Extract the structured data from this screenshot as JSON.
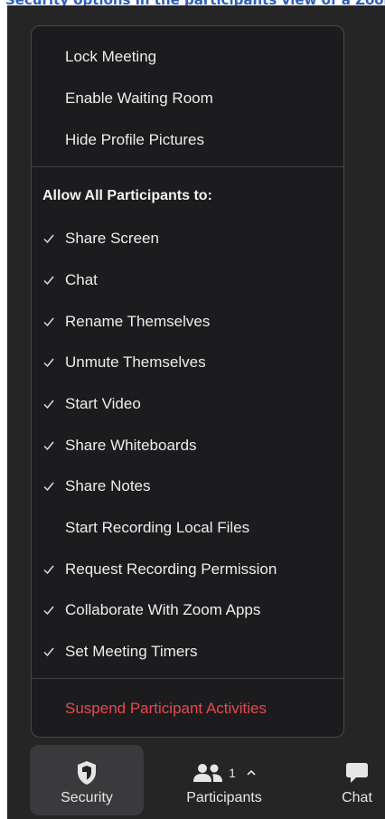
{
  "top_strip": {
    "text": "Security options in the participants view of a Zoom meeting"
  },
  "menu": {
    "top_items": [
      {
        "label": "Lock Meeting",
        "checked": false
      },
      {
        "label": "Enable Waiting Room",
        "checked": false
      },
      {
        "label": "Hide Profile Pictures",
        "checked": false
      }
    ],
    "section_heading": "Allow All Participants to:",
    "permissions": [
      {
        "label": "Share Screen",
        "checked": true
      },
      {
        "label": "Chat",
        "checked": true
      },
      {
        "label": "Rename Themselves",
        "checked": true
      },
      {
        "label": "Unmute Themselves",
        "checked": true
      },
      {
        "label": "Start Video",
        "checked": true
      },
      {
        "label": "Share Whiteboards",
        "checked": true
      },
      {
        "label": "Share Notes",
        "checked": true
      },
      {
        "label": "Start Recording Local Files",
        "checked": false
      },
      {
        "label": "Request Recording Permission",
        "checked": true
      },
      {
        "label": "Collaborate With Zoom Apps",
        "checked": true
      },
      {
        "label": "Set Meeting Timers",
        "checked": true
      }
    ],
    "suspend_label": "Suspend Participant Activities"
  },
  "toolbar": {
    "security_label": "Security",
    "security_icon": "shield-icon",
    "participants_label": "Participants",
    "participants_icon": "people-icon",
    "participants_count": "1",
    "chat_label": "Chat",
    "chat_icon": "chat-bubble-icon"
  },
  "colors": {
    "menu_bg": "#1c1c1e",
    "danger": "#e8484e",
    "toolbar_bg": "#252526",
    "active_button": "#3a3a3c"
  }
}
